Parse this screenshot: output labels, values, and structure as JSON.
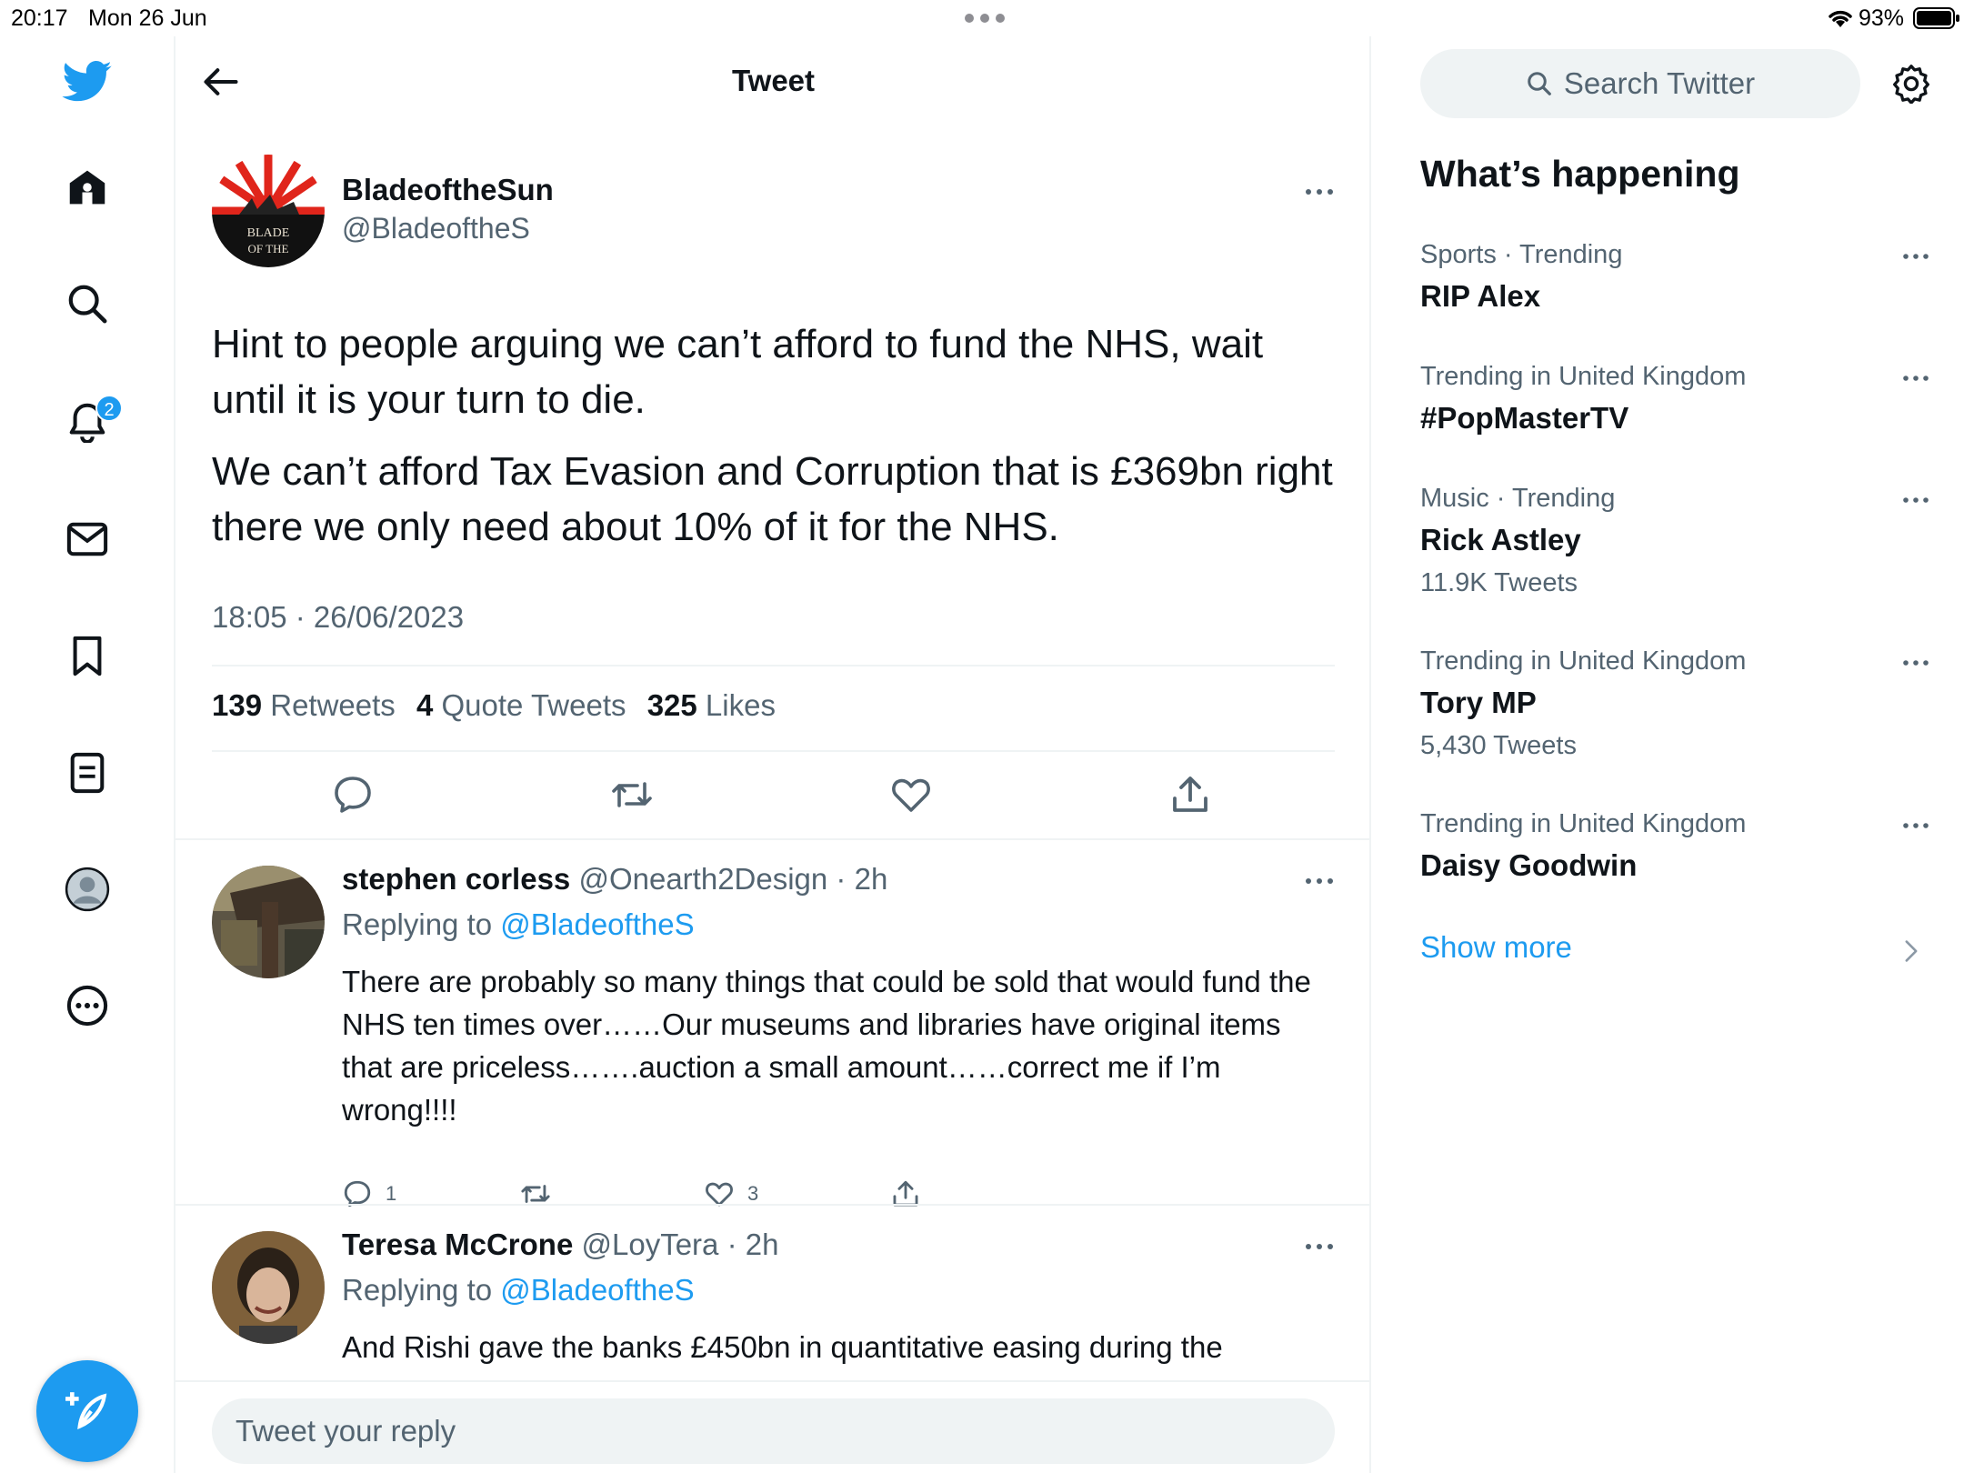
{
  "status_bar": {
    "time": "20:17",
    "date": "Mon 26 Jun",
    "battery": "93%"
  },
  "nav": {
    "icons": [
      "twitter-bird-icon",
      "home-icon",
      "search-icon",
      "bell-icon",
      "mail-icon",
      "bookmark-icon",
      "lists-icon",
      "profile-icon",
      "more-circle-icon"
    ],
    "notifications_badge": "2",
    "compose_icon": "compose-feather-icon"
  },
  "header": {
    "title": "Tweet"
  },
  "tweet": {
    "author_name": "BladeoftheSun",
    "author_handle": "@BladeoftheS",
    "paragraph_1": "Hint to people arguing we can’t afford to fund the NHS, wait until it is your turn to die.",
    "paragraph_2": "We can’t afford Tax Evasion and Corruption that is £369bn right there we only need about 10% of it for the NHS.",
    "timestamp": "18:05 · 26/06/2023",
    "retweets_count": "139",
    "retweets_label": "Retweets",
    "quotes_count": "4",
    "quotes_label": "Quote Tweets",
    "likes_count": "325",
    "likes_label": "Likes"
  },
  "replies": [
    {
      "name": "stephen corless",
      "meta": "@Onearth2Design · 2h",
      "replying_prefix": "Replying to",
      "replying_to": "@BladeoftheS",
      "text": "There are probably so many things that could be sold that would fund the NHS ten times over……Our museums and libraries have original items that are priceless…….auction a small amount……correct me if I’m wrong!!!!",
      "reply_count": "1",
      "like_count": "3"
    },
    {
      "name": "Teresa McCrone",
      "meta": "@LoyTera · 2h",
      "replying_prefix": "Replying to",
      "replying_to": "@BladeoftheS",
      "text": "And Rishi gave the banks £450bn in quantitative easing during the"
    }
  ],
  "reply_box": {
    "placeholder": "Tweet your reply"
  },
  "sidebar": {
    "search_placeholder": "Search Twitter",
    "whats_happening": "What’s happening",
    "trends": [
      {
        "meta": "Sports · Trending",
        "name": "RIP Alex",
        "count": ""
      },
      {
        "meta": "Trending in United Kingdom",
        "name": "#PopMasterTV",
        "count": ""
      },
      {
        "meta": "Music · Trending",
        "name": "Rick Astley",
        "count": "11.9K Tweets"
      },
      {
        "meta": "Trending in United Kingdom",
        "name": "Tory MP",
        "count": "5,430 Tweets"
      },
      {
        "meta": "Trending in United Kingdom",
        "name": "Daisy Goodwin",
        "count": ""
      }
    ],
    "show_more": "Show more"
  },
  "colors": {
    "accent": "#1d9bf0",
    "text_primary": "#0f1419",
    "text_secondary": "#536471",
    "divider": "#eff3f4"
  }
}
